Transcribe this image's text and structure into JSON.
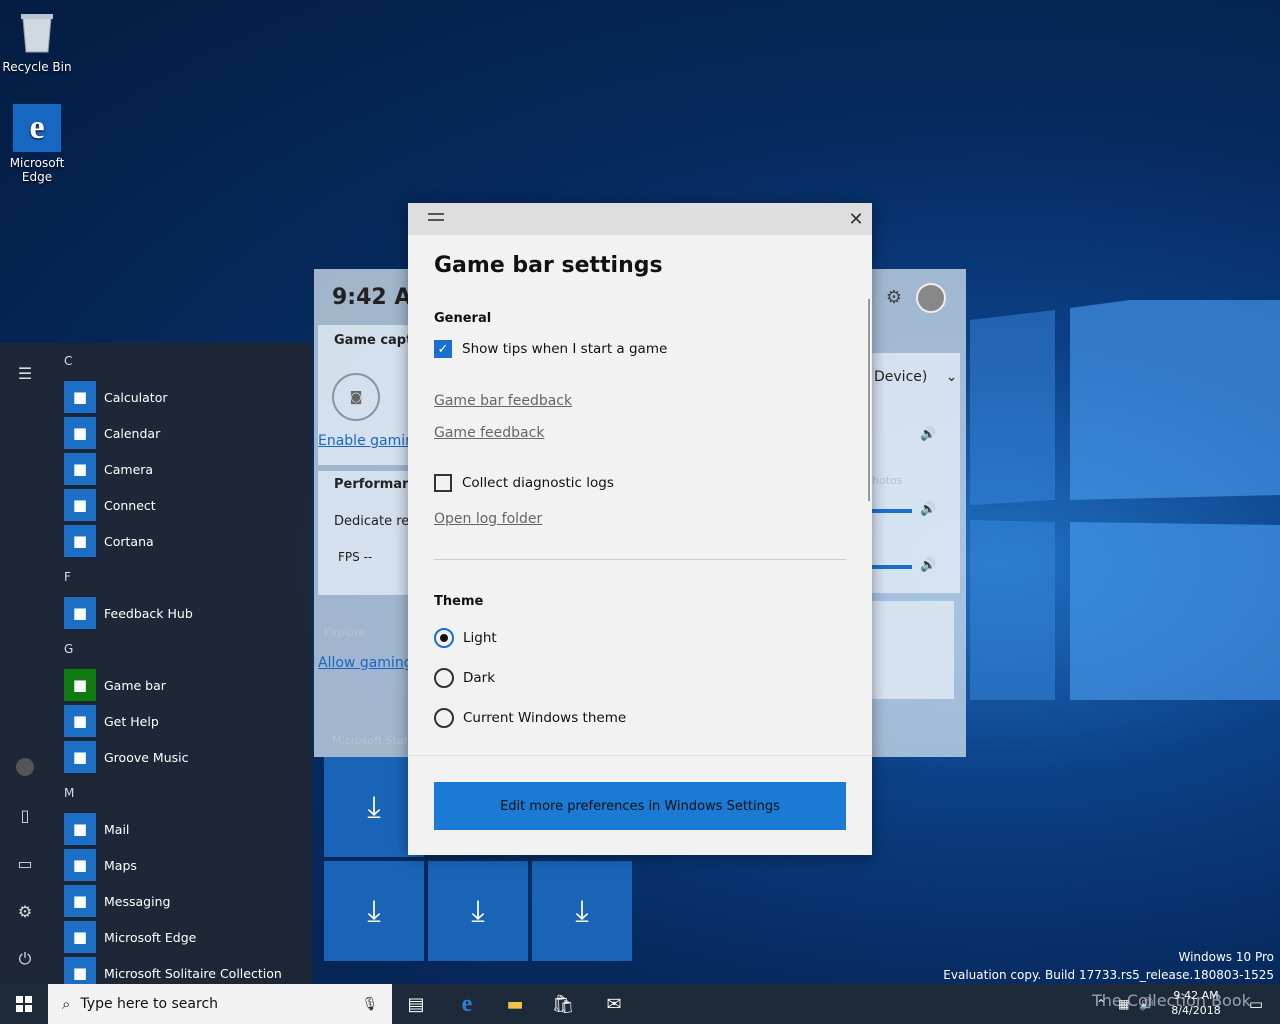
{
  "desktop": {
    "icons": [
      {
        "label": "Recycle Bin"
      },
      {
        "label": "Microsoft Edge"
      }
    ]
  },
  "start_menu": {
    "apps": [
      {
        "type": "letter",
        "label": "C"
      },
      {
        "type": "app",
        "label": "Calculator",
        "icon": "calculator-icon"
      },
      {
        "type": "app",
        "label": "Calendar",
        "icon": "calendar-icon"
      },
      {
        "type": "app",
        "label": "Camera",
        "icon": "camera-icon"
      },
      {
        "type": "app",
        "label": "Connect",
        "icon": "connect-icon"
      },
      {
        "type": "app",
        "label": "Cortana",
        "icon": "cortana-icon"
      },
      {
        "type": "letter",
        "label": "F"
      },
      {
        "type": "app",
        "label": "Feedback Hub",
        "icon": "feedback-hub-icon"
      },
      {
        "type": "letter",
        "label": "G"
      },
      {
        "type": "app",
        "label": "Game bar",
        "icon": "game-bar-icon"
      },
      {
        "type": "app",
        "label": "Get Help",
        "icon": "get-help-icon"
      },
      {
        "type": "app",
        "label": "Groove Music",
        "icon": "groove-music-icon"
      },
      {
        "type": "letter",
        "label": "M"
      },
      {
        "type": "app",
        "label": "Mail",
        "icon": "mail-icon"
      },
      {
        "type": "app",
        "label": "Maps",
        "icon": "maps-icon"
      },
      {
        "type": "app",
        "label": "Messaging",
        "icon": "messaging-icon"
      },
      {
        "type": "app",
        "label": "Microsoft Edge",
        "icon": "edge-icon"
      },
      {
        "type": "app",
        "label": "Microsoft Solitaire Collection",
        "icon": "solitaire-icon"
      }
    ]
  },
  "game_bar_widget": {
    "clock": "9:42 AM",
    "capture_title": "Game captu",
    "enable_link": "Enable gamin",
    "performance_title": "Performanc",
    "dedicate_label": "Dedicate res",
    "fps_label": "FPS --",
    "explore_label": "Explore",
    "allow_link": "Allow gaming",
    "store_label": "Microsoft Stor",
    "audio_device": "Device)",
    "photos_label": "hotos"
  },
  "dialog": {
    "title": "Game bar settings",
    "general": {
      "heading": "General",
      "show_tips": {
        "label": "Show tips when I start a game",
        "checked": true
      },
      "links": [
        "Game bar feedback",
        "Game feedback"
      ],
      "diagnostics": {
        "label": "Collect diagnostic logs",
        "checked": false
      },
      "log_link": "Open log folder"
    },
    "theme": {
      "heading": "Theme",
      "options": [
        {
          "label": "Light",
          "selected": true
        },
        {
          "label": "Dark",
          "selected": false
        },
        {
          "label": "Current Windows theme",
          "selected": false
        }
      ]
    },
    "footer_button": "Edit more preferences in Windows Settings"
  },
  "watermark": {
    "line1": "Windows 10 Pro",
    "line2": "Evaluation copy. Build 17733.rs5_release.180803-1525"
  },
  "taskbar": {
    "search_placeholder": "Type here to search",
    "time": "9:42 AM",
    "date": "8/4/2018",
    "brand": "The Collection Book"
  }
}
